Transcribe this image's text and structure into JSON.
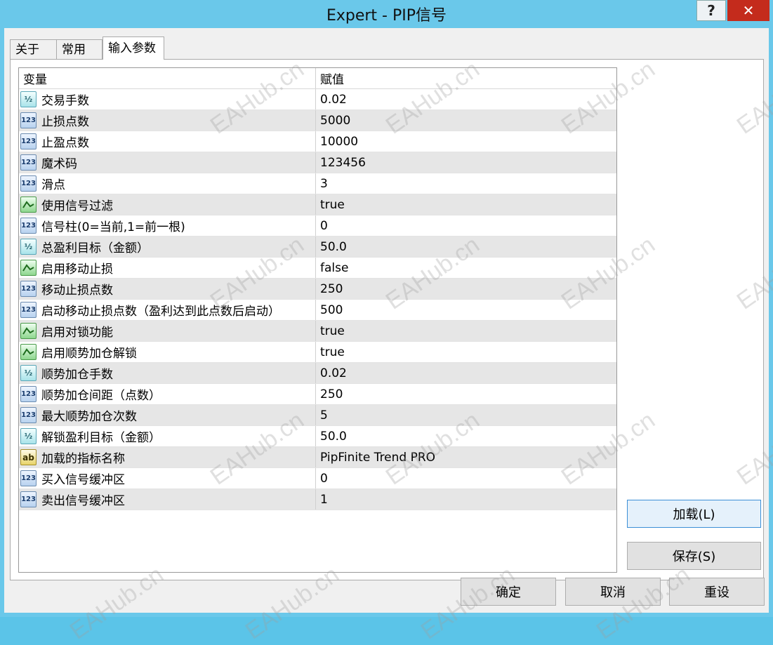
{
  "window": {
    "title": "Expert - PIP信号",
    "help_label": "?",
    "close_label": "✕"
  },
  "tabs": [
    {
      "label": "关于",
      "active": false
    },
    {
      "label": "常用",
      "active": false
    },
    {
      "label": "输入参数",
      "active": true
    }
  ],
  "grid": {
    "headers": {
      "name": "变量",
      "value": "赋值"
    },
    "rows": [
      {
        "type": "double",
        "icon": "double-type-icon",
        "name": "交易手数",
        "value": "0.02"
      },
      {
        "type": "int",
        "icon": "int-type-icon",
        "name": "止损点数",
        "value": "5000"
      },
      {
        "type": "int",
        "icon": "int-type-icon",
        "name": "止盈点数",
        "value": "10000"
      },
      {
        "type": "int",
        "icon": "int-type-icon",
        "name": "魔术码",
        "value": "123456"
      },
      {
        "type": "int",
        "icon": "int-type-icon",
        "name": "滑点",
        "value": "3"
      },
      {
        "type": "bool",
        "icon": "bool-type-icon",
        "name": "使用信号过滤",
        "value": "true"
      },
      {
        "type": "int",
        "icon": "int-type-icon",
        "name": "信号柱(0=当前,1=前一根)",
        "value": "0"
      },
      {
        "type": "double",
        "icon": "double-type-icon",
        "name": "总盈利目标（金额）",
        "value": "50.0"
      },
      {
        "type": "bool",
        "icon": "bool-type-icon",
        "name": "启用移动止损",
        "value": "false"
      },
      {
        "type": "int",
        "icon": "int-type-icon",
        "name": "移动止损点数",
        "value": "250"
      },
      {
        "type": "int",
        "icon": "int-type-icon",
        "name": "启动移动止损点数（盈利达到此点数后启动）",
        "value": "500"
      },
      {
        "type": "bool",
        "icon": "bool-type-icon",
        "name": "启用对锁功能",
        "value": "true"
      },
      {
        "type": "bool",
        "icon": "bool-type-icon",
        "name": "启用顺势加仓解锁",
        "value": "true"
      },
      {
        "type": "double",
        "icon": "double-type-icon",
        "name": "顺势加仓手数",
        "value": "0.02"
      },
      {
        "type": "int",
        "icon": "int-type-icon",
        "name": "顺势加仓间距（点数）",
        "value": "250"
      },
      {
        "type": "int",
        "icon": "int-type-icon",
        "name": "最大顺势加仓次数",
        "value": "5"
      },
      {
        "type": "double",
        "icon": "double-type-icon",
        "name": "解锁盈利目标（金额）",
        "value": "50.0"
      },
      {
        "type": "string",
        "icon": "string-type-icon",
        "name": "加载的指标名称",
        "value": "PipFinite Trend PRO"
      },
      {
        "type": "int",
        "icon": "int-type-icon",
        "name": "买入信号缓冲区",
        "value": "0"
      },
      {
        "type": "int",
        "icon": "int-type-icon",
        "name": "卖出信号缓冲区",
        "value": "1"
      }
    ]
  },
  "type_icon_text": {
    "int": "123",
    "double": "½",
    "bool": "",
    "string": "ab"
  },
  "side_buttons": {
    "load": "加载(L)",
    "save": "保存(S)"
  },
  "footer_buttons": {
    "ok": "确定",
    "cancel": "取消",
    "reset": "重设"
  },
  "watermark_text": "EAHub.cn",
  "colors": {
    "titlebar": "#6ac8ea",
    "close": "#c42b1c",
    "alt_row": "#e6e6e6"
  }
}
